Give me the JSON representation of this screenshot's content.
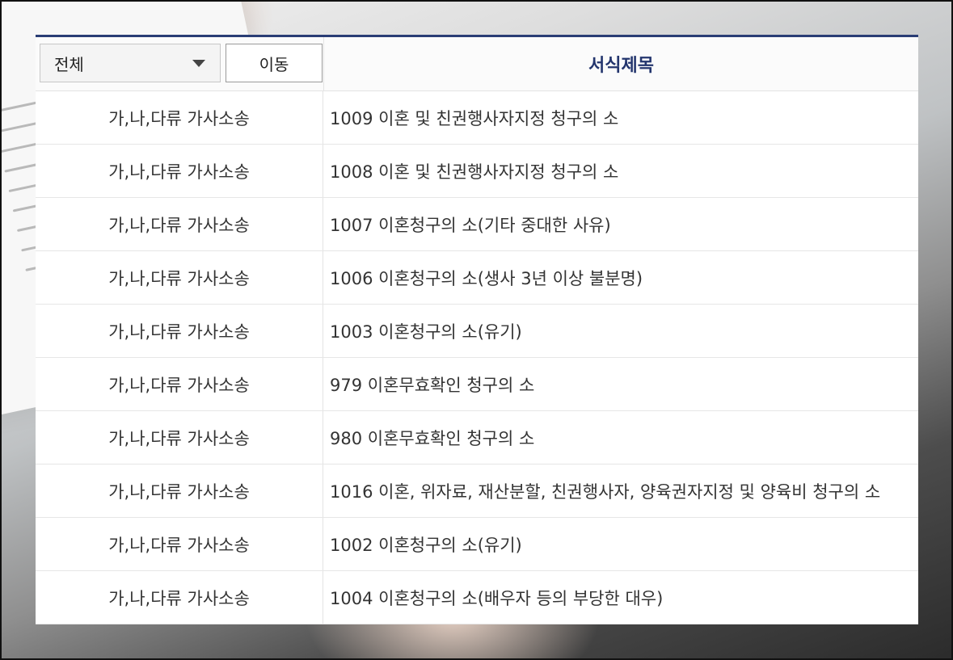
{
  "filter": {
    "selected": "전체",
    "go_label": "이동"
  },
  "table": {
    "title_header": "서식제목",
    "rows": [
      {
        "category": "가,나,다류 가사소송",
        "title": "1009 이혼 및 친권행사자지정 청구의 소"
      },
      {
        "category": "가,나,다류 가사소송",
        "title": "1008 이혼 및 친권행사자지정 청구의 소"
      },
      {
        "category": "가,나,다류 가사소송",
        "title": "1007 이혼청구의 소(기타 중대한 사유)"
      },
      {
        "category": "가,나,다류 가사소송",
        "title": "1006 이혼청구의 소(생사 3년 이상 불분명)"
      },
      {
        "category": "가,나,다류 가사소송",
        "title": "1003 이혼청구의 소(유기)"
      },
      {
        "category": "가,나,다류 가사소송",
        "title": "979 이혼무효확인 청구의 소"
      },
      {
        "category": "가,나,다류 가사소송",
        "title": "980 이혼무효확인 청구의 소"
      },
      {
        "category": "가,나,다류 가사소송",
        "title": "1016 이혼, 위자료, 재산분할, 친권행사자, 양육권자지정 및 양육비 청구의 소"
      },
      {
        "category": "가,나,다류 가사소송",
        "title": "1002 이혼청구의 소(유기)"
      },
      {
        "category": "가,나,다류 가사소송",
        "title": "1004 이혼청구의 소(배우자 등의 부당한 대우)"
      }
    ]
  }
}
